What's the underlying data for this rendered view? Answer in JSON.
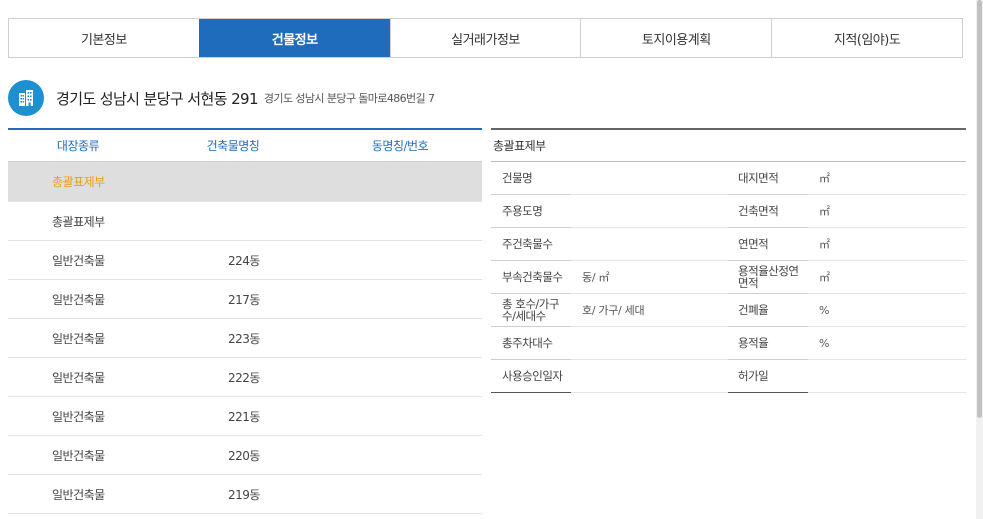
{
  "tabs": [
    {
      "label": "기본정보",
      "active": false
    },
    {
      "label": "건물정보",
      "active": true
    },
    {
      "label": "실거래가정보",
      "active": false
    },
    {
      "label": "토지이용계획",
      "active": false
    },
    {
      "label": "지적(임야)도",
      "active": false
    }
  ],
  "address": {
    "main": "경기도 성남시 분당구 서현동 291",
    "road": "경기도 성남시 분당구 돌마로486번길 7",
    "icon": "building-icon",
    "icon_color": "#1e8fd1"
  },
  "building_list": {
    "headers": [
      "대장종류",
      "건축물명칭",
      "동명칭/번호"
    ],
    "rows": [
      {
        "type": "총괄표제부",
        "name": "",
        "dong": "",
        "selected": true
      },
      {
        "type": "총괄표제부",
        "name": "",
        "dong": ""
      },
      {
        "type": "일반건축물",
        "name": "224동",
        "dong": ""
      },
      {
        "type": "일반건축물",
        "name": "217동",
        "dong": ""
      },
      {
        "type": "일반건축물",
        "name": "223동",
        "dong": ""
      },
      {
        "type": "일반건축물",
        "name": "222동",
        "dong": ""
      },
      {
        "type": "일반건축물",
        "name": "221동",
        "dong": ""
      },
      {
        "type": "일반건축물",
        "name": "220동",
        "dong": ""
      },
      {
        "type": "일반건축물",
        "name": "219동",
        "dong": ""
      }
    ]
  },
  "summary": {
    "title": "총괄표제부",
    "rows": [
      {
        "label1": "건물명",
        "value1": "",
        "label2": "대지면적",
        "value2": "㎡"
      },
      {
        "label1": "주용도명",
        "value1": "",
        "label2": "건축면적",
        "value2": "㎡"
      },
      {
        "label1": "주건축물수",
        "value1": "",
        "label2": "연면적",
        "value2": "㎡"
      },
      {
        "label1": "부속건축물수",
        "value1": "동/ ㎡",
        "label2": "용적율산정연면적",
        "value2": "㎡"
      },
      {
        "label1": "총 호수/가구수/세대수",
        "value1": "호/ 가구/ 세대",
        "label2": "건폐율",
        "value2": "%"
      },
      {
        "label1": "총주차대수",
        "value1": "",
        "label2": "용적율",
        "value2": "%"
      },
      {
        "label1": "사용승인일자",
        "value1": "",
        "label2": "허가일",
        "value2": ""
      }
    ]
  },
  "colors": {
    "accent": "#1f6cbd",
    "selected_text": "#f39a16",
    "selected_bg": "#dedede"
  }
}
